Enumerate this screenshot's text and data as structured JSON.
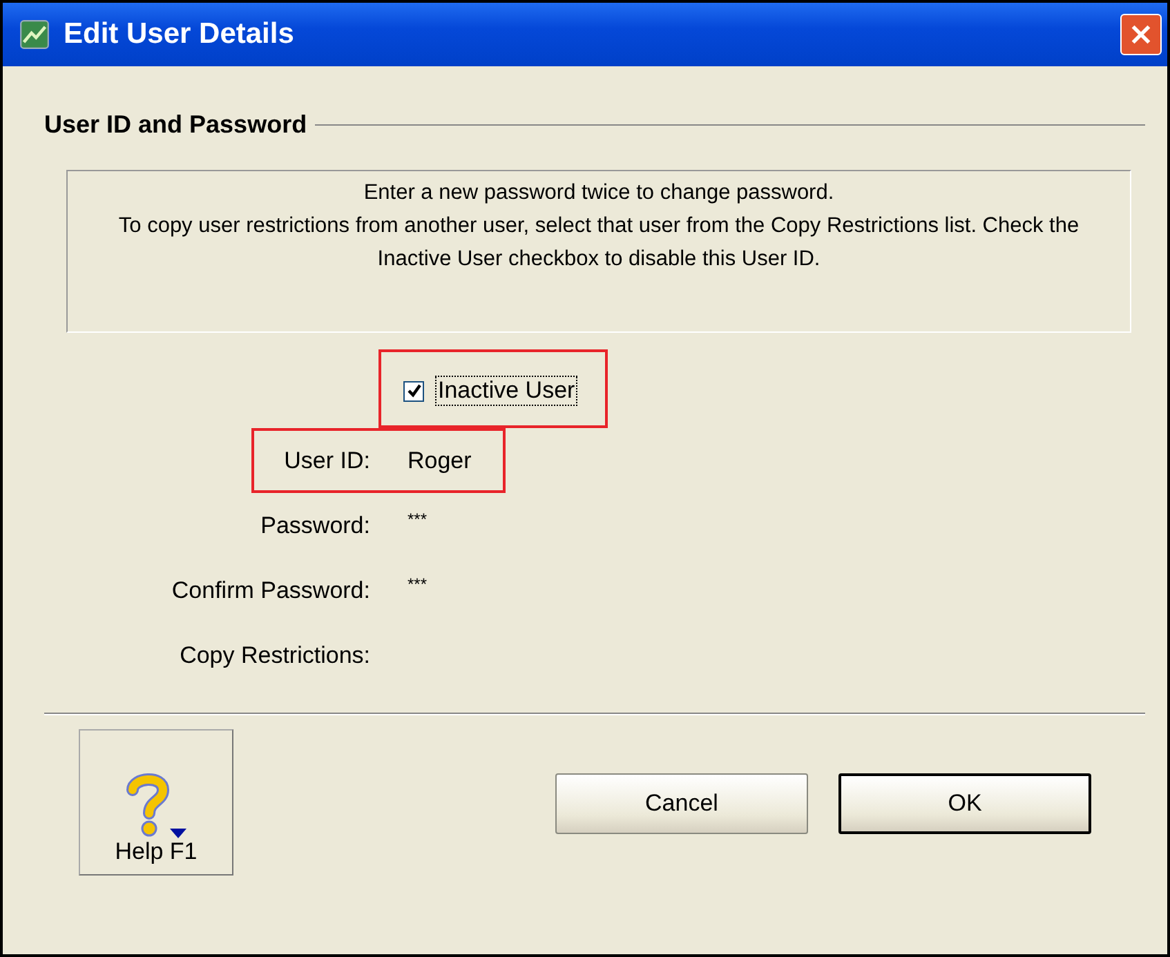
{
  "window": {
    "title": "Edit User Details"
  },
  "section": {
    "title": "User ID and Password"
  },
  "instructions": [
    "Enter a new password twice to change password.",
    "To copy user restrictions from another user, select that user from the Copy Restrictions list.  Check the Inactive User checkbox to disable this User ID."
  ],
  "inactive_checkbox": {
    "label": "Inactive User",
    "checked": true,
    "highlighted": true
  },
  "fields": [
    {
      "label": "User ID:",
      "value": "Roger",
      "highlighted": true
    },
    {
      "label": "Password:",
      "value": "***",
      "highlighted": false
    },
    {
      "label": "Confirm Password:",
      "value": "***",
      "highlighted": false
    },
    {
      "label": "Copy Restrictions:",
      "highlighted": false
    }
  ],
  "help_button": {
    "label": "Help F1"
  },
  "buttons": [
    {
      "label": "Cancel",
      "default": false
    },
    {
      "label": "OK",
      "default": true
    }
  ]
}
